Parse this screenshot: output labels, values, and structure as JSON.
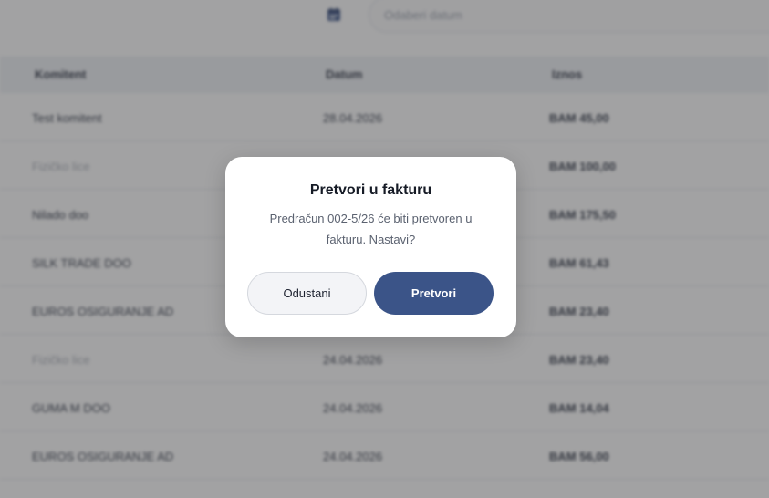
{
  "filter": {
    "date_placeholder": "Odaberi datum",
    "calendar_icon": "calendar-icon",
    "accent_color": "#3b5488"
  },
  "table": {
    "headers": [
      "Komitent",
      "Datum",
      "Iznos"
    ],
    "rows": [
      {
        "client": "Test komitent",
        "date": "28.04.2026",
        "amount": "BAM 45,00",
        "muted": false
      },
      {
        "client": "Fizičko lice",
        "date": "",
        "amount": "BAM 100,00",
        "muted": true
      },
      {
        "client": "Nilado doo",
        "date": "",
        "amount": "BAM 175,50",
        "muted": false
      },
      {
        "client": "SILK TRADE DOO",
        "date": "",
        "amount": "BAM 61,43",
        "muted": false
      },
      {
        "client": "EUROS OSIGURANJE AD",
        "date": "",
        "amount": "BAM 23,40",
        "muted": false
      },
      {
        "client": "Fizičko lice",
        "date": "24.04.2026",
        "amount": "BAM 23,40",
        "muted": true
      },
      {
        "client": "GUMA M DOO",
        "date": "24.04.2026",
        "amount": "BAM 14,04",
        "muted": false
      },
      {
        "client": "EUROS OSIGURANJE AD",
        "date": "24.04.2026",
        "amount": "BAM 56,00",
        "muted": false
      }
    ]
  },
  "modal": {
    "title": "Pretvori u fakturu",
    "message": "Predračun 002-5/26 će biti pretvoren u fakturu. Nastavi?",
    "cancel_label": "Odustani",
    "confirm_label": "Pretvori",
    "confirm_color": "#3b5488"
  }
}
